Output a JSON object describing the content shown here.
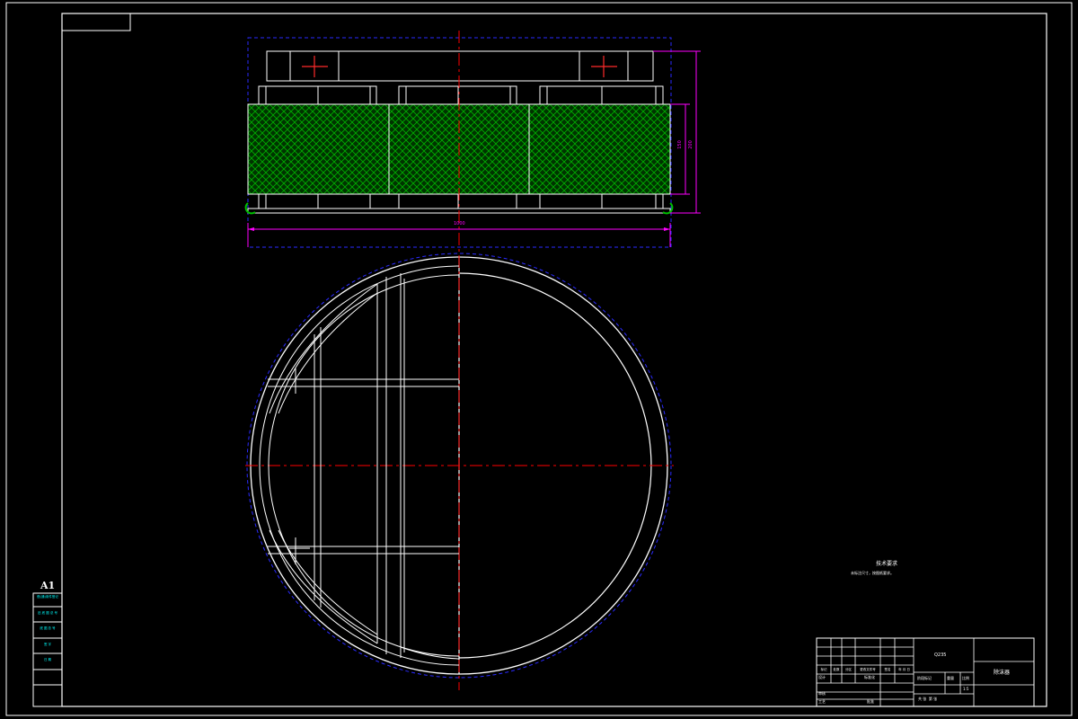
{
  "sheet": {
    "size_label": "A1"
  },
  "left_strip": {
    "rows": [
      "借(通)用件登记",
      "旧 底 图 总 号",
      "底 图 总 号",
      "签 字",
      "日 期"
    ]
  },
  "tech_notes": {
    "title": "技术要求",
    "line1": "未标注尺寸，按图纸要求。"
  },
  "dimensions": {
    "bottom_width": "1000",
    "right_inner": "150",
    "right_outer": "200"
  },
  "title_block": {
    "header": [
      "标记",
      "处数",
      "分区",
      "更改文件号",
      "签名",
      "年 月 日"
    ],
    "roles": [
      "设计",
      "审核",
      "工艺"
    ],
    "extra_labels": [
      "标准化",
      "批准"
    ],
    "stage_labels": [
      "阶段标记",
      "重量",
      "比例"
    ],
    "scale": "1:5",
    "sheet_info": "共 张  第 张",
    "material": "Q235",
    "part_name": "除沫器"
  },
  "colors": {
    "outline": "#ffffff",
    "centerline": "#ff0000",
    "dimension": "#ff00ff",
    "boundary": "#0000ff",
    "hatch": "#00c000",
    "marker": "#ff2a2a",
    "text_cyan": "#00ffff",
    "text_yellow": "#ffff00"
  }
}
